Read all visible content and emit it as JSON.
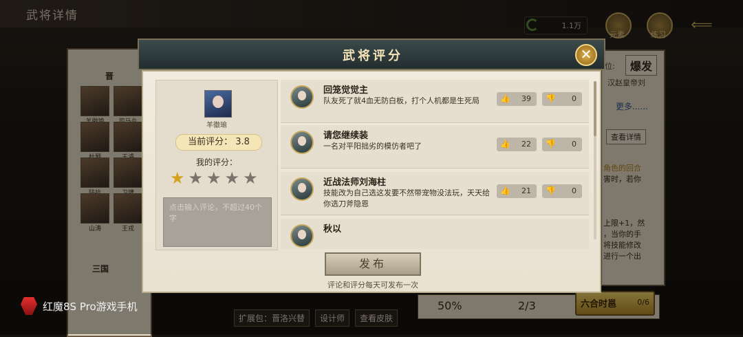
{
  "background": {
    "page_title": "武将详情",
    "currency_value": "1.1万",
    "top_buttons": [
      "元素",
      "练习"
    ],
    "left_list": {
      "category1": "晋",
      "heroes": [
        "羊徽瑜",
        "司马炎",
        "杜预",
        "王濬",
        "陆抗",
        "卫瓘",
        "山涛",
        "王戎"
      ],
      "category2": "三国"
    },
    "right_panel": {
      "position_label": "位:",
      "badge": "爆发",
      "emperor": "汉赵皇帝刘",
      "more": "更多......",
      "detail_button": "查看详情",
      "text1": "角色的回合",
      "text2": "害时，若你",
      "text3": "上限+1，然",
      "text4": "，当你的手",
      "text5": "将技能修改",
      "text6": "进行一个出"
    },
    "stats": {
      "stat1": "50%",
      "stat2": "2/3"
    },
    "skill_button": {
      "label": "六合时邕",
      "count": "0/6"
    },
    "footer_buttons": [
      "扩展包：晋洛兴替",
      "设计师",
      "查看皮肤"
    ],
    "watermark": "红魔8S Pro游戏手机"
  },
  "modal": {
    "title": "武将评分",
    "close_icon": "close-icon",
    "hero_name": "羊徽瑜",
    "current_score_label": "当前评分：",
    "current_score": "3.8",
    "my_score_label": "我的评分：",
    "stars_filled": 1,
    "stars_total": 5,
    "comment_placeholder": "点击输入评论，不超过40个字",
    "comments": [
      {
        "name": "回笼觉觉主",
        "text": "队友死了就4血无防白板，打个人机都是生死局",
        "up": "39",
        "down": "0"
      },
      {
        "name": "请您继续装",
        "text": "一名对平阳拙劣的模仿者吧了",
        "up": "22",
        "down": "0"
      },
      {
        "name": "近战法师刘海柱",
        "text": "技能改为自己选这发要不然带宠物没法玩，天天给你选刀斧隐恩",
        "up": "21",
        "down": "0"
      },
      {
        "name": "秋以",
        "text": "",
        "up": "",
        "down": ""
      }
    ],
    "publish_label": "发布",
    "publish_note": "评论和评分每天可发布一次"
  }
}
